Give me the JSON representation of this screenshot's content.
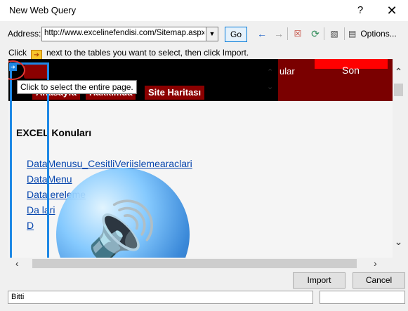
{
  "window": {
    "title": "New Web Query",
    "help_glyph": "?",
    "close_glyph": "✕"
  },
  "toolbar": {
    "address_label": "Address:",
    "address_value": "http://www.excelinefendisi.com/Sitemap.aspx",
    "go_label": "Go",
    "options_label": "Options...",
    "icons": [
      "back-arrow-icon",
      "forward-arrow-icon",
      "stop-icon",
      "refresh-icon",
      "save-query-icon",
      "options-icon"
    ]
  },
  "hint": {
    "before": "Click",
    "after": "next to the tables you want to select, then click Import."
  },
  "page": {
    "tooltip": "Click to select the entire page.",
    "header_menu": [
      "Anasayfa",
      "Hakkımda",
      "Site Haritası"
    ],
    "header_right_fragment": "ular",
    "header_son": "Son",
    "section_title": "EXCEL Konuları",
    "links": [
      "DataMenusu_CesitliVeriislemearaclari",
      "DataMenu",
      "Data                    ereleme",
      "Da                      lari",
      "D"
    ]
  },
  "buttons": {
    "import": "Import",
    "cancel": "Cancel"
  },
  "status": {
    "text": "Bitti"
  }
}
